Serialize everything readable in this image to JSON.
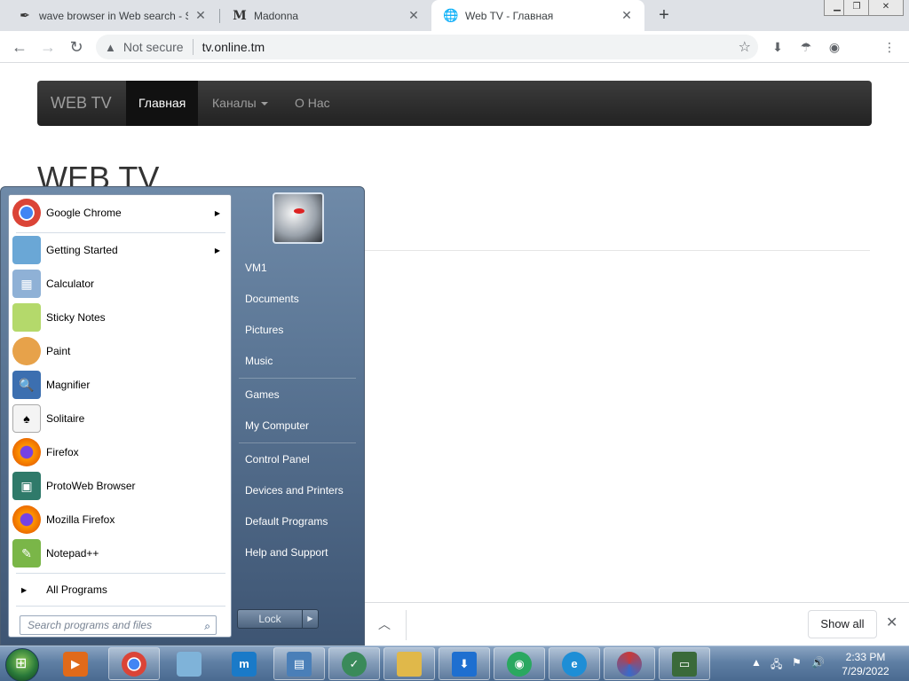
{
  "browser": {
    "tabs": [
      {
        "title": "wave browser in Web search - S",
        "icon": "feather-icon"
      },
      {
        "title": "Madonna",
        "icon": "m-logo-icon"
      },
      {
        "title": "Web TV - Главная",
        "icon": "globe-icon",
        "active": true
      }
    ],
    "security_label": "Not secure",
    "url": "tv.online.tm"
  },
  "page": {
    "brand": "WEB TV",
    "nav": [
      "Главная",
      "Каналы",
      "О Нас"
    ],
    "heading": "WEB TV"
  },
  "download_bar": {
    "show_all": "Show all"
  },
  "start_menu": {
    "programs": [
      {
        "label": "Google Chrome",
        "has_submenu": true,
        "icon": "chrome-icon",
        "color": "#db4437"
      },
      {
        "label": "Getting Started",
        "has_submenu": true,
        "icon": "getting-started-icon",
        "color": "#6aa7d6"
      },
      {
        "label": "Calculator",
        "icon": "calculator-icon",
        "color": "#8fb1d6"
      },
      {
        "label": "Sticky Notes",
        "icon": "sticky-notes-icon",
        "color": "#b4d96b"
      },
      {
        "label": "Paint",
        "icon": "paint-icon",
        "color": "#e7a24a"
      },
      {
        "label": "Magnifier",
        "icon": "magnifier-icon",
        "color": "#3c6fb0"
      },
      {
        "label": "Solitaire",
        "icon": "solitaire-icon",
        "color": "#4b8a4b"
      },
      {
        "label": "Firefox",
        "icon": "firefox-icon",
        "color": "#e66000"
      },
      {
        "label": "ProtoWeb Browser",
        "icon": "protoweb-icon",
        "color": "#2f7a6a"
      },
      {
        "label": "Mozilla Firefox",
        "icon": "mozilla-firefox-icon",
        "color": "#e66000"
      },
      {
        "label": "Notepad++",
        "icon": "notepadpp-icon",
        "color": "#7ab648"
      }
    ],
    "all_programs": "All Programs",
    "search_placeholder": "Search programs and files",
    "right_items": [
      "VM1",
      "Documents",
      "Pictures",
      "Music",
      "Games",
      "My Computer",
      "Control Panel",
      "Devices and Printers",
      "Default Programs",
      "Help and Support"
    ],
    "lock_label": "Lock"
  },
  "taskbar": {
    "apps": [
      {
        "name": "media-player-icon",
        "color": "#e06a1a"
      },
      {
        "name": "chrome-icon",
        "color": "#db4437"
      },
      {
        "name": "notebook-icon",
        "color": "#7fb3d9"
      },
      {
        "name": "maxthon-icon",
        "color": "#1a7ac8"
      },
      {
        "name": "control-panel-icon",
        "color": "#4a7fb8"
      },
      {
        "name": "checklist-icon",
        "color": "#3a8a5a"
      },
      {
        "name": "file-explorer-icon",
        "color": "#e0b84a"
      },
      {
        "name": "download-manager-icon",
        "color": "#1e6fd0"
      },
      {
        "name": "tor-browser-icon",
        "color": "#2aa860"
      },
      {
        "name": "internet-explorer-icon",
        "color": "#1e8ed6"
      },
      {
        "name": "opera-icon",
        "color": "#c83a3a"
      },
      {
        "name": "monitor-app-icon",
        "color": "#3a6a3a"
      }
    ],
    "time": "2:33 PM",
    "date": "7/29/2022"
  }
}
